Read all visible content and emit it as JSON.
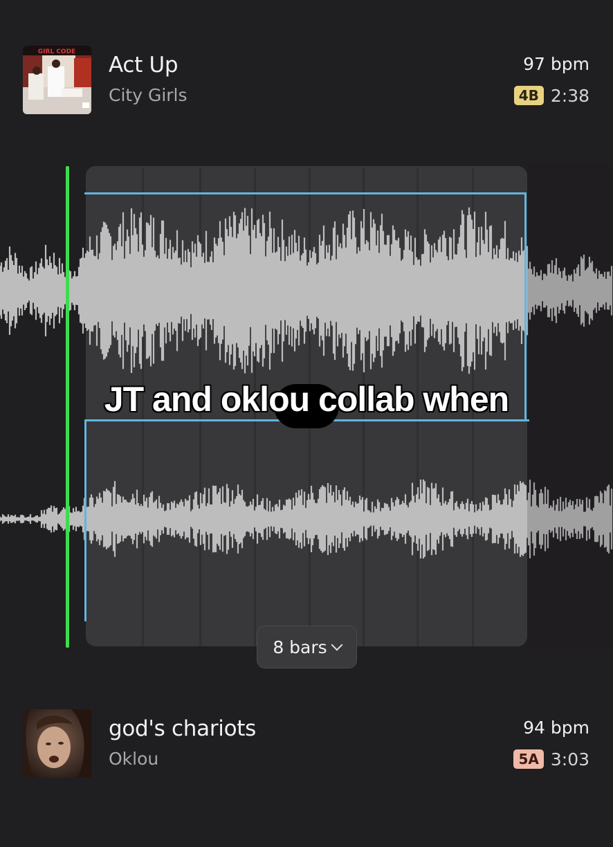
{
  "top_track": {
    "title": "Act Up",
    "artist": "City Girls",
    "bpm": "97 bpm",
    "key": "4B",
    "duration": "2:38",
    "album_art_text": "GIRL CODE"
  },
  "bottom_track": {
    "title": "god's chariots",
    "artist": "Oklou",
    "bpm": "94 bpm",
    "key": "5A",
    "duration": "3:03"
  },
  "loop_length": {
    "label": "8 bars"
  },
  "caption": "JT and oklou collab when",
  "colors": {
    "background": "#1f1e20",
    "panel": "#38373a",
    "waveform": "#bdbdbd",
    "selection": "#5fb6e0",
    "playhead": "#3ddc4f",
    "key_4b": "#e8d281",
    "key_5a": "#f0b9a8"
  }
}
